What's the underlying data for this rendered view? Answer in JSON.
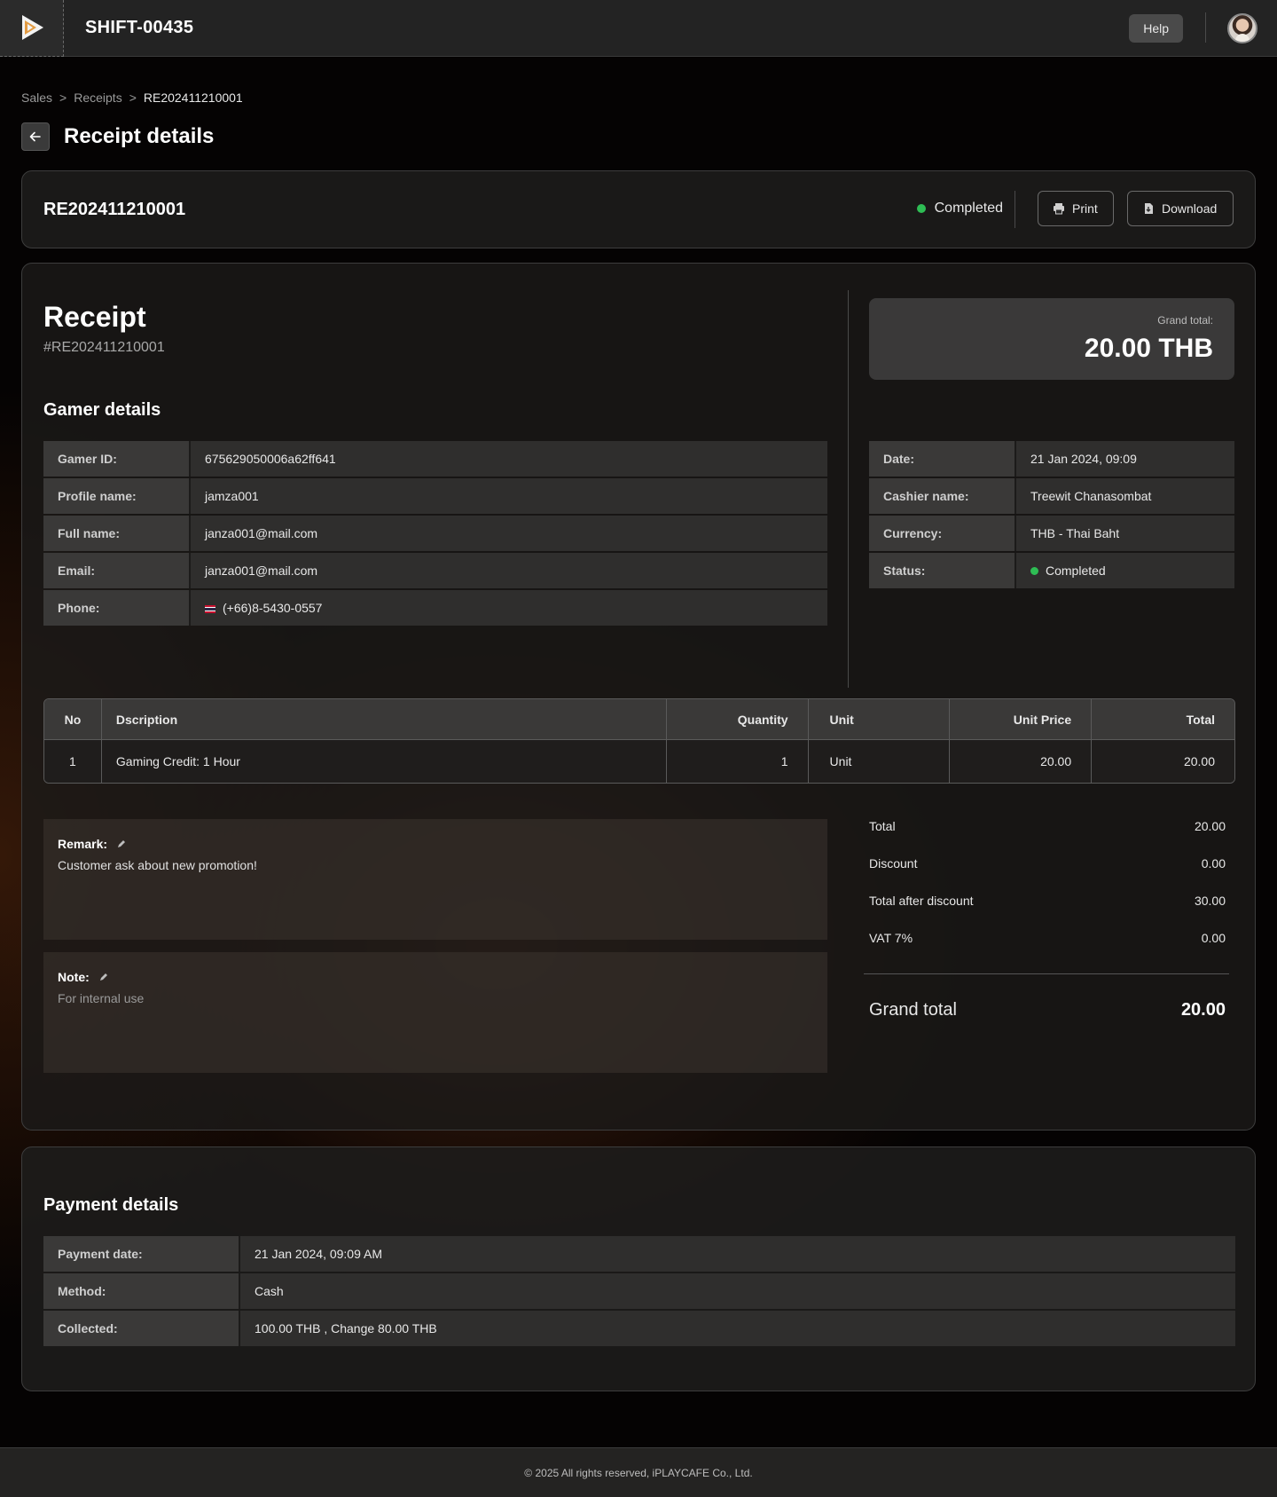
{
  "header": {
    "app_title": "SHIFT-00435",
    "help_label": "Help",
    "logo_icon": "play-logo-icon",
    "avatar_icon": "user-avatar"
  },
  "breadcrumb": {
    "items": [
      "Sales",
      "Receipts",
      "RE202411210001"
    ],
    "separator": ">"
  },
  "page": {
    "title": "Receipt details",
    "back_icon": "arrow-left-icon"
  },
  "summary_card": {
    "receipt_id": "RE202411210001",
    "status": "Completed",
    "status_color": "#2ebd54",
    "print_label": "Print",
    "download_label": "Download"
  },
  "receipt": {
    "heading": "Receipt",
    "number": "#RE202411210001",
    "grand_total_label": "Grand total:",
    "grand_total_value": "20.00 THB",
    "gamer_section_title": "Gamer details",
    "gamer_details": [
      {
        "label": "Gamer ID:",
        "value": "675629050006a62ff641"
      },
      {
        "label": "Profile name:",
        "value": "jamza001"
      },
      {
        "label": "Full name:",
        "value": "janza001@mail.com"
      },
      {
        "label": "Email:",
        "value": "janza001@mail.com"
      },
      {
        "label": "Phone:",
        "value": "(+66)8-5430-0557"
      }
    ],
    "info": [
      {
        "label": "Date:",
        "value": "21 Jan 2024, 09:09"
      },
      {
        "label": "Cashier name:",
        "value": "Treewit Chanasombat"
      },
      {
        "label": "Currency:",
        "value": "THB - Thai Baht"
      },
      {
        "label": "Status:",
        "value": "Completed"
      }
    ],
    "items_table": {
      "columns": [
        "No",
        "Dscription",
        "Quantity",
        "Unit",
        "Unit Price",
        "Total"
      ],
      "rows": [
        {
          "no": "1",
          "description": "Gaming Credit: 1 Hour",
          "quantity": "1",
          "unit": "Unit",
          "unit_price": "20.00",
          "total": "20.00"
        }
      ]
    },
    "remark": {
      "label": "Remark:",
      "text": "Customer ask about new promotion!"
    },
    "note": {
      "label": "Note:",
      "placeholder": "For internal use"
    },
    "totals": [
      {
        "label": "Total",
        "value": "20.00"
      },
      {
        "label": "Discount",
        "value": "0.00"
      },
      {
        "label": "Total after discount",
        "value": "30.00"
      },
      {
        "label": "VAT 7%",
        "value": "0.00"
      }
    ],
    "grand_total_row": {
      "label": "Grand total",
      "value": "20.00"
    }
  },
  "payment": {
    "section_title": "Payment details",
    "rows": [
      {
        "label": "Payment date:",
        "value": "21 Jan 2024, 09:09 AM"
      },
      {
        "label": "Method:",
        "value": "Cash"
      },
      {
        "label": "Collected:",
        "value": "100.00 THB , Change 80.00 THB"
      }
    ]
  },
  "footer": {
    "text": "© 2025 All rights reserved, iPLAYCAFE Co., Ltd."
  }
}
